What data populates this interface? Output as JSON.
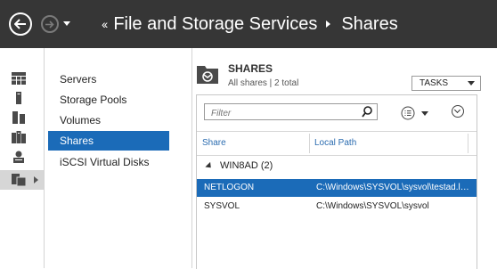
{
  "header": {
    "breadcrumb_parent": "File and Storage Services",
    "breadcrumb_current": "Shares",
    "dbl_chevron": "‹‹"
  },
  "icon_rail": {
    "items": [
      {
        "icon": "dashboard-icon"
      },
      {
        "icon": "local-server-icon"
      },
      {
        "icon": "all-servers-icon"
      },
      {
        "icon": "server-group-icon"
      },
      {
        "icon": "ad-ds-icon"
      },
      {
        "icon": "file-storage-icon",
        "selected": true
      }
    ]
  },
  "nav": {
    "items": [
      {
        "label": "Servers"
      },
      {
        "label": "Storage Pools"
      },
      {
        "label": "Volumes"
      },
      {
        "label": "Shares",
        "selected": true
      },
      {
        "label": "iSCSI Virtual Disks"
      }
    ]
  },
  "shares": {
    "title": "SHARES",
    "subtitle": "All shares | 2 total",
    "tasks_label": "TASKS",
    "filter_placeholder": "Filter",
    "columns": [
      "Share",
      "Local Path"
    ],
    "group": "WIN8AD (2)",
    "rows": [
      {
        "share": "NETLOGON",
        "path": "C:\\Windows\\SYSVOL\\sysvol\\testad.local\\SCRIPTS",
        "selected": true
      },
      {
        "share": "SYSVOL",
        "path": "C:\\Windows\\SYSVOL\\sysvol"
      }
    ]
  },
  "colors": {
    "topbar": "#363636",
    "accent": "#1b6bb8",
    "header_link": "#2b6cb0"
  }
}
